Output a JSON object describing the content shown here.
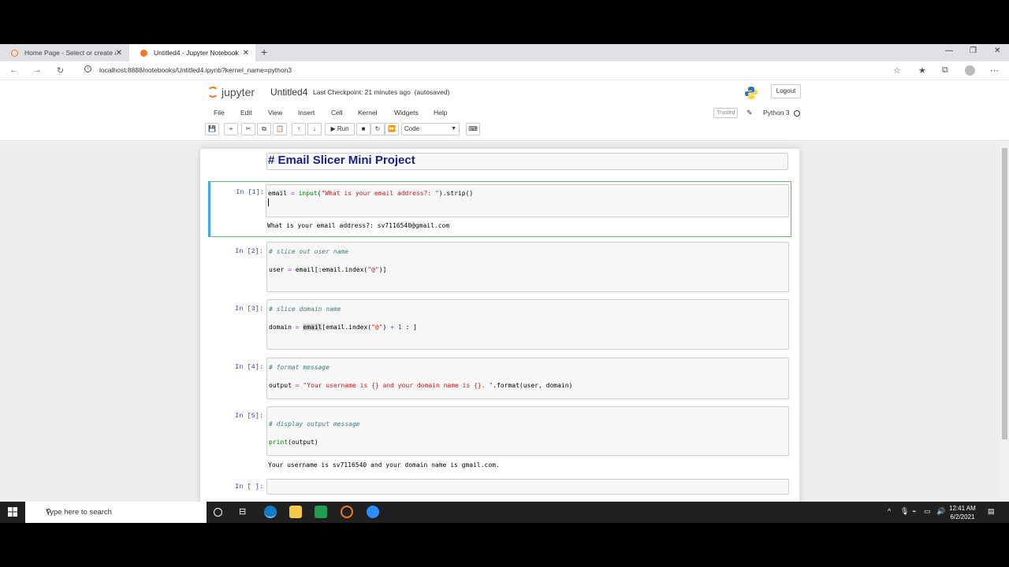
{
  "browser": {
    "tabs": [
      {
        "label": "Home Page - Select or create a r",
        "active": false
      },
      {
        "label": "Untitled4 - Jupyter Notebook",
        "active": true
      }
    ],
    "url": "localhost:8888/notebooks/Untitled4.ipynb?kernel_name=python3"
  },
  "jupyter": {
    "logo_text": "jupyter",
    "notebook_name": "Untitled4",
    "checkpoint": "Last Checkpoint: 21 minutes ago",
    "autosaved": "(autosaved)",
    "logout": "Logout",
    "menu": [
      "File",
      "Edit",
      "View",
      "Insert",
      "Cell",
      "Kernel",
      "Widgets",
      "Help"
    ],
    "trusted": "Trusted",
    "kernel": "Python 3",
    "run_label": "Run",
    "cell_type": "Code"
  },
  "cells": {
    "title": "# Email Slicer Mini Project",
    "c1": {
      "prompt": "In [1]:",
      "output": "What is your email address?: sv7116540@gmail.com"
    },
    "c2": {
      "prompt": "In [2]:",
      "comment": "# slice out user name"
    },
    "c3": {
      "prompt": "In [3]:",
      "comment": "# slice domain name"
    },
    "c4": {
      "prompt": "In [4]:",
      "comment": "# format message"
    },
    "c5": {
      "prompt": "In [5]:",
      "comment": "# display output message",
      "code": "print(output)",
      "output": "Your username is sv7116540 and your domain name is gmail.com."
    },
    "c6": {
      "prompt": "In [ ]:"
    }
  },
  "taskbar": {
    "search_placeholder": "Type here to search",
    "time": "12:41 AM",
    "date": "6/2/2021"
  },
  "colors": {
    "accent_orange": "#f37726",
    "selected_cell_border": "#66bb6a",
    "heading_blue": "#1a237e"
  }
}
